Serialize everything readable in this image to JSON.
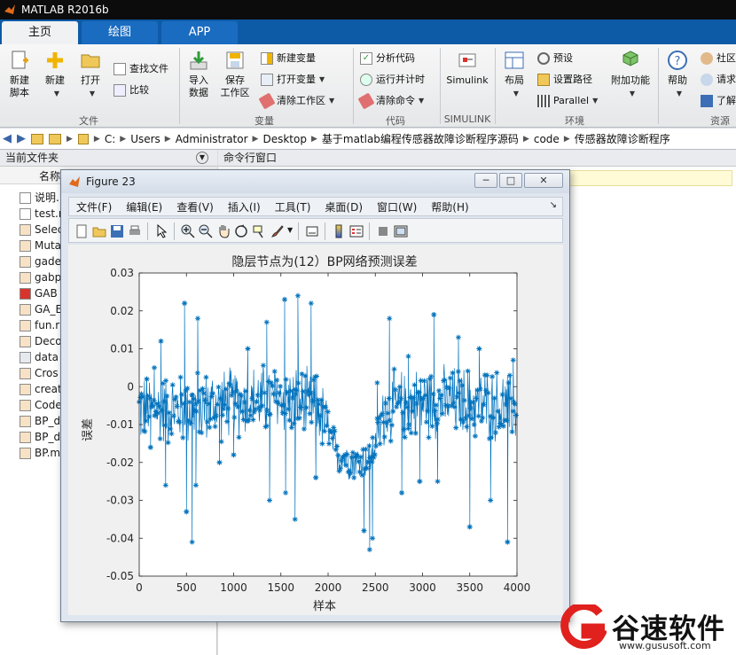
{
  "window": {
    "title": "MATLAB R2016b"
  },
  "tabs": [
    {
      "label": "主页"
    },
    {
      "label": "绘图"
    },
    {
      "label": "APP"
    }
  ],
  "ribbon": {
    "file": {
      "new_script": "新建\n脚本",
      "new": "新建",
      "open": "打开",
      "find_files": "查找文件",
      "compare": "比较",
      "group": "文件"
    },
    "variable": {
      "import": "导入\n数据",
      "save_ws": "保存\n工作区",
      "new_var": "新建变量",
      "open_var": "打开变量",
      "clear_ws": "清除工作区",
      "group": "变量"
    },
    "code": {
      "analyze": "分析代码",
      "run_time": "运行并计时",
      "clear_cmd": "清除命令",
      "group": "代码"
    },
    "simulink": {
      "label": "Simulink",
      "group": "SIMULINK"
    },
    "environment": {
      "layout": "布局",
      "prefs": "预设",
      "set_path": "设置路径",
      "parallel": "Parallel",
      "addons": "附加功能",
      "group": "环境"
    },
    "resources": {
      "help": "帮助",
      "community": "社区",
      "request": "请求",
      "learn": "了解",
      "group": "资源"
    }
  },
  "address": {
    "crumbs": [
      "C:",
      "Users",
      "Administrator",
      "Desktop",
      "基于matlab编程传感器故障诊断程序源码",
      "code",
      "传感器故障诊断程序"
    ]
  },
  "panels": {
    "current_folder": "当前文件夹",
    "command_window": "命令行窗口",
    "name_header": "名称"
  },
  "files": [
    "说明.",
    "test.r",
    "Selec",
    "Muta",
    "gade",
    "gabp",
    "GAB",
    "GA_E",
    "fun.r",
    "Deco",
    "data",
    "Cros",
    "creat",
    "Code",
    "BP_d",
    "BP_d",
    "BP.m"
  ],
  "figure": {
    "title": "Figure 23",
    "menus": [
      "文件(F)",
      "编辑(E)",
      "查看(V)",
      "插入(I)",
      "工具(T)",
      "桌面(D)",
      "窗口(W)",
      "帮助(H)"
    ]
  },
  "chart_data": {
    "type": "line",
    "title": "隐层节点为(12）BP网络预测误差",
    "xlabel": "样本",
    "ylabel": "误差",
    "xlim": [
      0,
      4000
    ],
    "ylim": [
      -0.05,
      0.03
    ],
    "xticks": [
      0,
      500,
      1000,
      1500,
      2000,
      2500,
      3000,
      3500,
      4000
    ],
    "yticks": [
      -0.05,
      -0.04,
      -0.03,
      -0.02,
      -0.01,
      0,
      0.01,
      0.02,
      0.03
    ],
    "xticklabels": [
      "0",
      "500",
      "1000",
      "1500",
      "2000",
      "2500",
      "3000",
      "3500",
      "4000"
    ],
    "yticklabels": [
      "-0.05",
      "-0.04",
      "-0.03",
      "-0.02",
      "-0.01",
      "0",
      "0.01",
      "0.02",
      "0.03"
    ],
    "marker": "*",
    "color": "#0072bd",
    "grid": false,
    "baseline_trend": [
      {
        "x": 0,
        "y": -0.006
      },
      {
        "x": 500,
        "y": -0.006
      },
      {
        "x": 1000,
        "y": -0.004
      },
      {
        "x": 1500,
        "y": -0.003
      },
      {
        "x": 1900,
        "y": -0.006
      },
      {
        "x": 2100,
        "y": -0.018
      },
      {
        "x": 2300,
        "y": -0.02
      },
      {
        "x": 2450,
        "y": -0.019
      },
      {
        "x": 2600,
        "y": -0.006
      },
      {
        "x": 3000,
        "y": -0.004
      },
      {
        "x": 3500,
        "y": -0.004
      },
      {
        "x": 4000,
        "y": -0.006
      }
    ],
    "spikes": [
      {
        "x": 80,
        "y": 0.002
      },
      {
        "x": 120,
        "y": -0.016
      },
      {
        "x": 160,
        "y": 0.005
      },
      {
        "x": 230,
        "y": 0.012
      },
      {
        "x": 280,
        "y": -0.026
      },
      {
        "x": 480,
        "y": 0.022
      },
      {
        "x": 500,
        "y": -0.033
      },
      {
        "x": 560,
        "y": -0.041
      },
      {
        "x": 600,
        "y": -0.026
      },
      {
        "x": 620,
        "y": 0.018
      },
      {
        "x": 850,
        "y": -0.02
      },
      {
        "x": 1000,
        "y": -0.018
      },
      {
        "x": 1150,
        "y": 0.01
      },
      {
        "x": 1350,
        "y": 0.017
      },
      {
        "x": 1380,
        "y": -0.03
      },
      {
        "x": 1540,
        "y": 0.023
      },
      {
        "x": 1550,
        "y": -0.028
      },
      {
        "x": 1680,
        "y": 0.024
      },
      {
        "x": 1650,
        "y": -0.035
      },
      {
        "x": 1820,
        "y": 0.022
      },
      {
        "x": 1870,
        "y": -0.024
      },
      {
        "x": 2380,
        "y": -0.038
      },
      {
        "x": 2440,
        "y": -0.043
      },
      {
        "x": 2470,
        "y": -0.04
      },
      {
        "x": 2520,
        "y": 0.001
      },
      {
        "x": 2650,
        "y": 0.018
      },
      {
        "x": 2780,
        "y": -0.028
      },
      {
        "x": 2850,
        "y": 0.008
      },
      {
        "x": 2970,
        "y": -0.025
      },
      {
        "x": 3120,
        "y": 0.019
      },
      {
        "x": 3160,
        "y": -0.025
      },
      {
        "x": 3380,
        "y": 0.013
      },
      {
        "x": 3500,
        "y": -0.037
      },
      {
        "x": 3600,
        "y": 0.01
      },
      {
        "x": 3720,
        "y": -0.03
      },
      {
        "x": 3900,
        "y": -0.041
      },
      {
        "x": 3960,
        "y": 0.007
      }
    ]
  },
  "watermark": {
    "brand": "谷速软件",
    "url": "www.gususoft.com"
  },
  "colors": {
    "accent": "#0d5aa7",
    "series": "#0072bd",
    "ribbon": "#e6e7e9"
  }
}
